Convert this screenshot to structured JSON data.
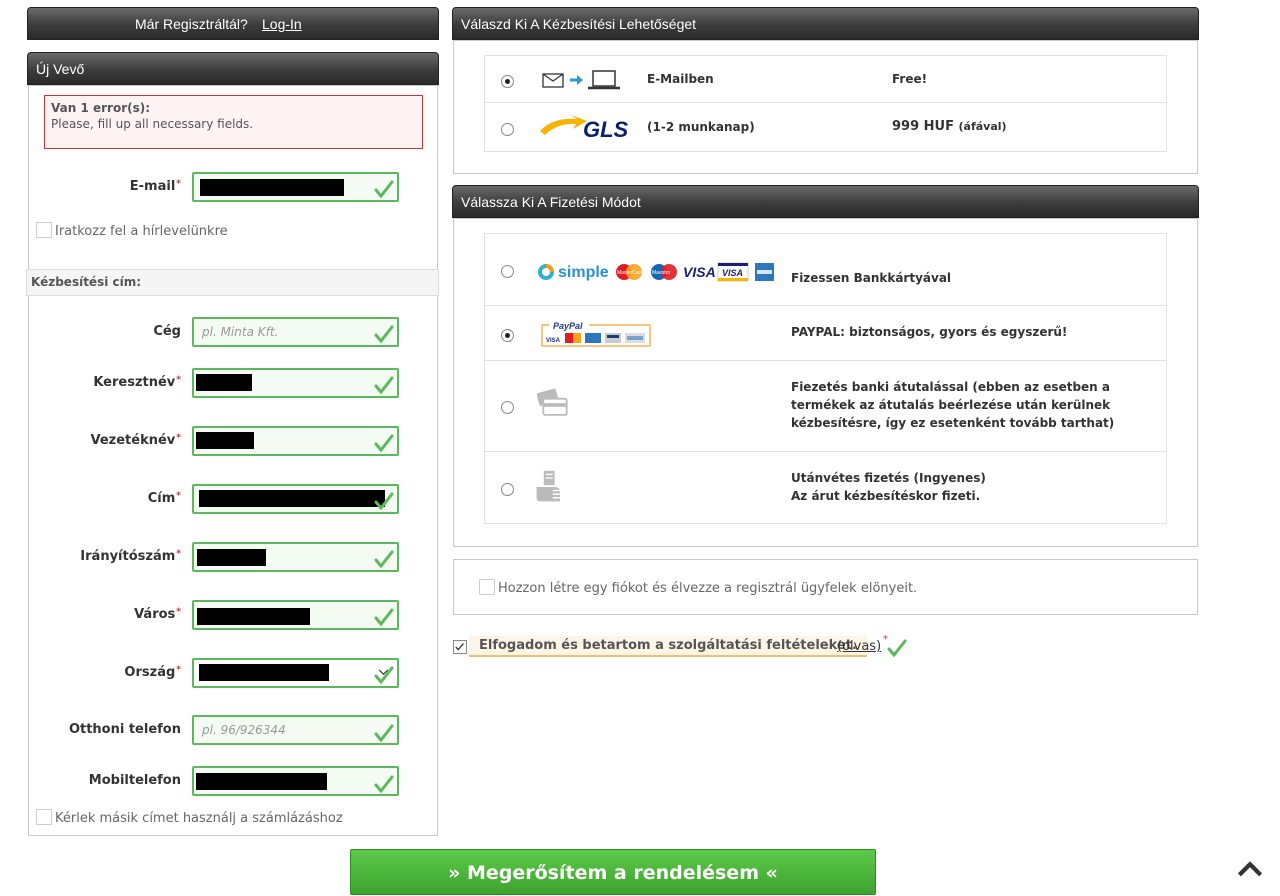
{
  "login_bar": {
    "text": "Már Regisztráltál?",
    "link": "Log-In"
  },
  "new_customer": {
    "title": "Új Vevő",
    "error_title": "Van 1 error(s):",
    "error_msg": "Please, fill up all necessary fields.",
    "email_label": "E-mail",
    "newsletter_label": "Iratkozz fel a hírlevelünkre",
    "delivery_section": "Kézbesítési cím:",
    "fields": {
      "company": {
        "label": "Cég",
        "placeholder": "pl. Minta Kft."
      },
      "firstname": {
        "label": "Keresztnév"
      },
      "lastname": {
        "label": "Vezetéknév"
      },
      "address": {
        "label": "Cím"
      },
      "zip": {
        "label": "Irányítószám"
      },
      "city": {
        "label": "Város"
      },
      "country": {
        "label": "Ország"
      },
      "home_phone": {
        "label": "Otthoni telefon",
        "placeholder": "pl. 96/926344"
      },
      "mobile": {
        "label": "Mobiltelefon"
      }
    },
    "billing_label": "Kérlek másik címet használj a számlázáshoz"
  },
  "shipping": {
    "title": "Válaszd Ki A Kézbesítési Lehetőséget",
    "options": [
      {
        "name": "E-Mailben",
        "price": "Free!",
        "price_note": "",
        "selected": true,
        "icon": "email-to-laptop-icon"
      },
      {
        "name": "(1-2 munkanap)",
        "price": "999 HUF",
        "price_note": "(áfával)",
        "selected": false,
        "icon": "gls-logo",
        "logo_text": "GLS"
      }
    ]
  },
  "payment": {
    "title": "Válassza Ki A Fizetési Módot",
    "options": [
      {
        "text": "Fizessen Bankkártyával",
        "selected": false,
        "logo_text": "simple",
        "cards": [
          "MasterCard",
          "Maestro",
          "VISA",
          "VISA"
        ]
      },
      {
        "text": "PAYPAL: biztonságos, gyors és egyszerű!",
        "selected": true,
        "logo_text": "PayPal",
        "cards": [
          "VISA"
        ]
      },
      {
        "text": "Fiezetés banki átutalással (ebben az esetben a termékek az átutalás beérlezése után kerülnek kézbesítésre, így ez esetenként tovább tarthat)",
        "selected": false
      },
      {
        "text_line1": "Utánvétes fizetés (Ingyenes)",
        "text_line2": "Az árut kézbesítéskor fizeti.",
        "selected": false
      }
    ]
  },
  "account": {
    "label": "Hozzon létre egy fiókot és élvezze a regisztrál ügyfelek elönyeit."
  },
  "terms": {
    "label": "Elfogadom és betartom a szolgáltatási feltételeket.",
    "link": "(olvas)",
    "required_mark": "*"
  },
  "submit": {
    "label": "» Megerősítem a rendelésem «"
  },
  "colors": {
    "accent_green": "#4cae3c",
    "error_border": "#cc3333",
    "header_dark": "#3c3c3c"
  }
}
